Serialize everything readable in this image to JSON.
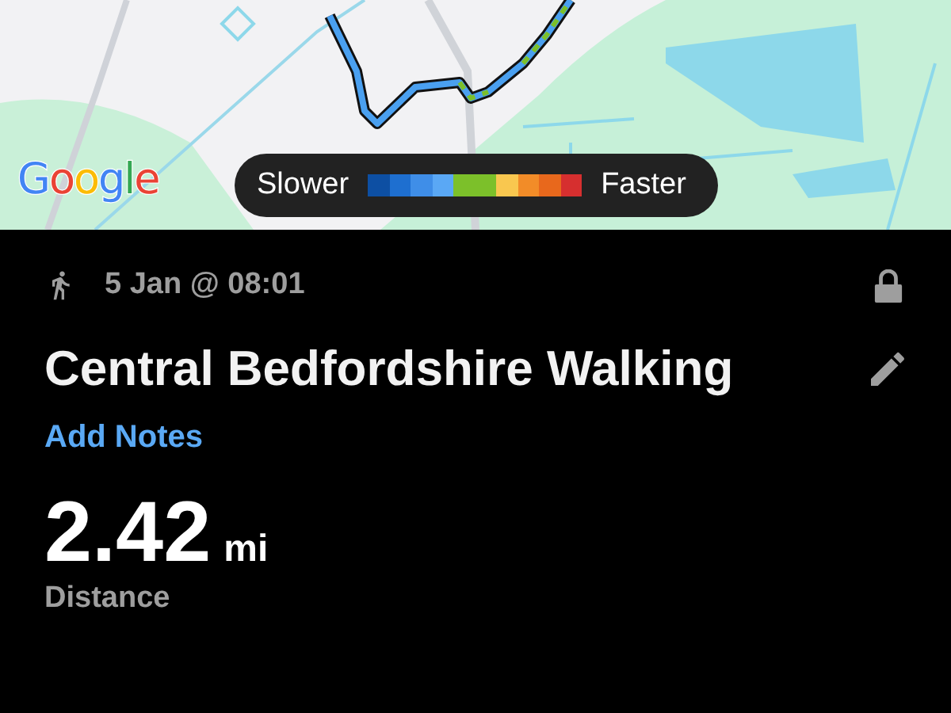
{
  "map": {
    "kind": "picture",
    "logo": "Google",
    "legend": {
      "low_label": "Slower",
      "high_label": "Faster",
      "steps": [
        {
          "color": "#0d4fa3"
        },
        {
          "color": "#1e6fd0"
        },
        {
          "color": "#3f8ee8"
        },
        {
          "color": "#5aa8f5"
        },
        {
          "color": "#7cc02a"
        },
        {
          "color": "#7cc02a"
        },
        {
          "color": "#f9c74f"
        },
        {
          "color": "#f28c28"
        },
        {
          "color": "#e8681c"
        },
        {
          "color": "#d62f2f"
        }
      ]
    }
  },
  "activity": {
    "date": "5 Jan @ 08:01",
    "locked": true,
    "title": "Central Bedfordshire Walking",
    "notes_link": "Add Notes",
    "distance": {
      "value": "2.42",
      "unit": "mi",
      "label": "Distance"
    }
  }
}
